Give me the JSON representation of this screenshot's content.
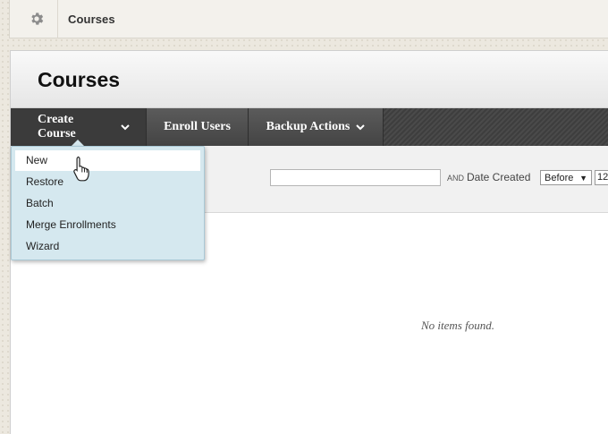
{
  "breadcrumb": {
    "icon": "gear-icon",
    "label": "Courses"
  },
  "page": {
    "title": "Courses"
  },
  "actionbar": {
    "create_course": "Create Course",
    "enroll_users": "Enroll Users",
    "backup_actions": "Backup Actions"
  },
  "create_menu": {
    "items": [
      {
        "label": "New"
      },
      {
        "label": "Restore"
      },
      {
        "label": "Batch"
      },
      {
        "label": "Merge Enrollments"
      },
      {
        "label": "Wizard"
      }
    ]
  },
  "filter": {
    "search_value": "",
    "and_label": "AND",
    "date_label": "Date Created",
    "date_operator": "Before",
    "date_value": "12"
  },
  "results": {
    "empty_message": "No items found."
  },
  "colors": {
    "menu_bg": "#d5e8ef",
    "actionbar_bg": "#444444"
  }
}
